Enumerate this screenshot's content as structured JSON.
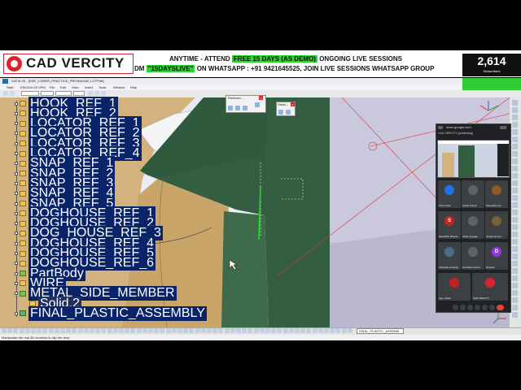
{
  "banner": {
    "brand": "CAD VERCITY",
    "line1_pre": "ANYTIME - ATTEND",
    "line1_highlight": "FREE 15 DAYS (AS DEMO)",
    "line1_post": "ONGOING LIVE SESSIONS",
    "line2_pre": "DM",
    "line2_highlight": "\"15DAYSLIVE\"",
    "line2_post": "ON WHATSAPP : +91 9421645525, JOIN LIVE SESSIONS WHATSAPP GROUP",
    "subscriber_count": "2,614",
    "subscriber_label": "Subscribers"
  },
  "window": {
    "title": "CATIA V5 - [DSE_LOWER_PRACTICE_PRIYANKAM_LGTPart]",
    "menu": [
      "Start",
      "ENOVIA V5 VPM",
      "File",
      "Edit",
      "View",
      "Insert",
      "Tools",
      "Window",
      "Help"
    ]
  },
  "tree": {
    "items": [
      {
        "label": "HOOK_REF_1",
        "type": "ref"
      },
      {
        "label": "HOOK_REF_2",
        "type": "ref"
      },
      {
        "label": "LOCATOR_REF_1",
        "type": "ref"
      },
      {
        "label": "LOCATOR_REF_2",
        "type": "ref"
      },
      {
        "label": "LOCATOR_REF_3",
        "type": "ref"
      },
      {
        "label": "LOCATOR_REF_4",
        "type": "ref"
      },
      {
        "label": "SNAP_REF_1",
        "type": "ref"
      },
      {
        "label": "SNAP_REF_2",
        "type": "ref"
      },
      {
        "label": "SNAP_REF_3",
        "type": "ref"
      },
      {
        "label": "SNAP_REF_4",
        "type": "ref"
      },
      {
        "label": "SNAP_REF_5",
        "type": "ref"
      },
      {
        "label": "DOGHOUSE_REF_1",
        "type": "ref"
      },
      {
        "label": "DOGHOUSE_REF_2",
        "type": "ref"
      },
      {
        "label": "DOG_HOUSE_REF_3",
        "type": "ref"
      },
      {
        "label": "DOGHOUSE_REF_4",
        "type": "ref"
      },
      {
        "label": "DOGHOUSE_REF_5",
        "type": "ref"
      },
      {
        "label": "DOGHOUSE_REF_6",
        "type": "ref"
      },
      {
        "label": "PartBody",
        "type": "body"
      },
      {
        "label": "WIRE",
        "type": "ref"
      },
      {
        "label": "METAL_SIDE_MEMBER",
        "type": "body"
      },
      {
        "label": "Solid.2",
        "type": "solid"
      },
      {
        "label": "FINAL_PLASTIC_ASSEMBLY",
        "type": "asm"
      }
    ]
  },
  "dialogs": {
    "reference_title": "Referenc...",
    "sketch_title": "Sketc..."
  },
  "bottom": {
    "doc_select": "FINAL_PLASTIC_ASSEMB"
  },
  "status": {
    "text": "Manipulate the real 3D sections to clip the view"
  },
  "meet": {
    "url": "meet.google.com",
    "tab": "CAD VERCITY (presenting)",
    "participants": [
      {
        "name": "Tina Christ..",
        "initial": "",
        "color": "#1a73e8"
      },
      {
        "name": "Harsh Kumar",
        "initial": "",
        "color": "#5f6368"
      },
      {
        "name": "Paravathy Aru",
        "initial": "",
        "color": "#8e5a2b"
      },
      {
        "name": "Saurabha Bhavan",
        "initial": "S",
        "color": "#c5221f"
      },
      {
        "name": "nikhil_thiyaga..",
        "initial": "",
        "color": "#5f6368"
      },
      {
        "name": "Jangpreet Kor..",
        "initial": "",
        "color": "#7b5e3a"
      },
      {
        "name": "Vishwale sanshan",
        "initial": "",
        "color": "#4a6b8a"
      },
      {
        "name": "Suvikash Kumar",
        "initial": "",
        "color": "#5f6368"
      },
      {
        "name": "Deepak",
        "initial": "D",
        "color": "#9334e6"
      },
      {
        "name": "Ajay Yadav",
        "initial": "",
        "color": "#c5221f"
      },
      {
        "name": "CAD VERCITY",
        "initial": "",
        "color": "#d9232d"
      }
    ]
  },
  "colors": {
    "tree_highlight": "#0a246a",
    "part_green": "#345e42",
    "part_tan": "#d3b27d",
    "brand_red": "#d9232d",
    "promo_green": "#29d42e"
  }
}
